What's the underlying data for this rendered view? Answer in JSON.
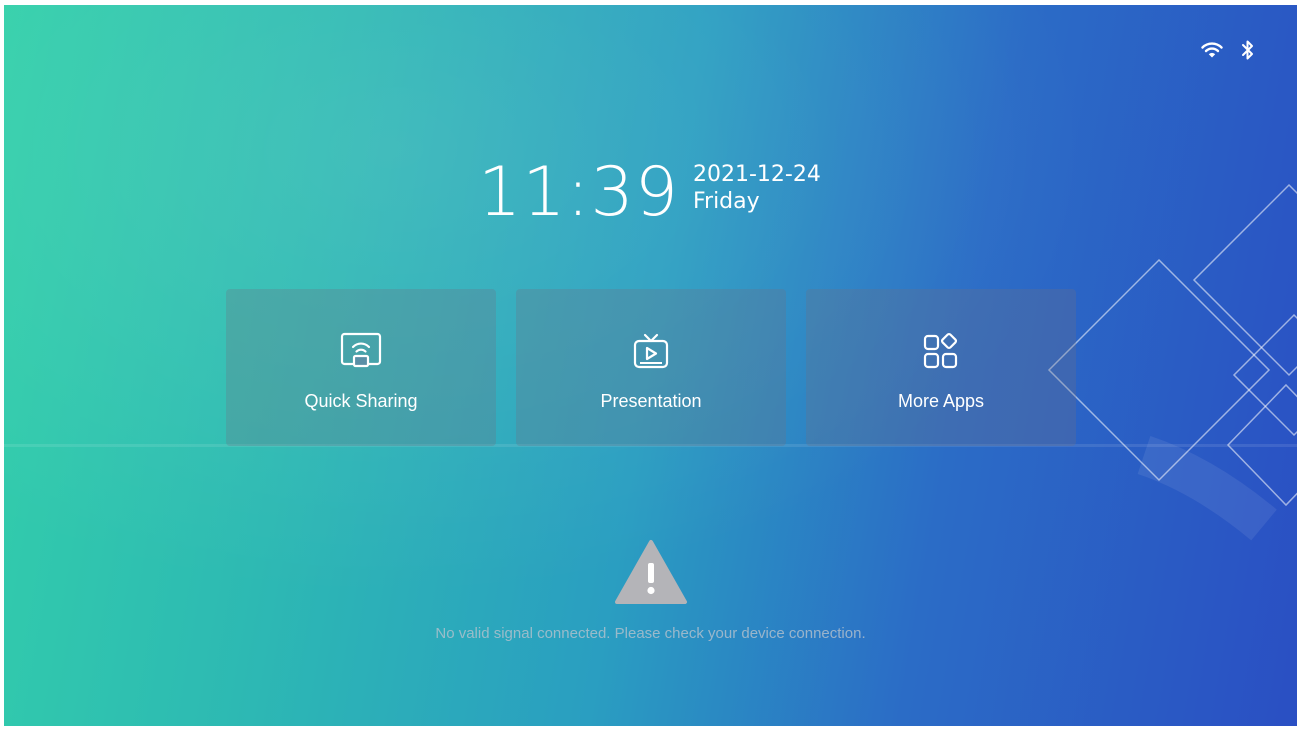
{
  "status_bar": {
    "icons": [
      "wifi-icon",
      "bluetooth-icon"
    ]
  },
  "clock": {
    "time": "11:39",
    "date": "2021-12-24",
    "weekday": "Friday"
  },
  "tiles": [
    {
      "label": "Quick Sharing",
      "icon": "screen-cast-icon"
    },
    {
      "label": "Presentation",
      "icon": "tv-play-icon"
    },
    {
      "label": "More Apps",
      "icon": "apps-grid-icon"
    }
  ],
  "alert": {
    "icon": "warning-triangle-icon",
    "message": "No valid signal connected. Please check your device connection."
  },
  "colors": {
    "gradient_start": "#33d0aa",
    "gradient_end": "#2a4fc3",
    "text": "#ffffff",
    "warning_icon": "#b4b4b8"
  }
}
